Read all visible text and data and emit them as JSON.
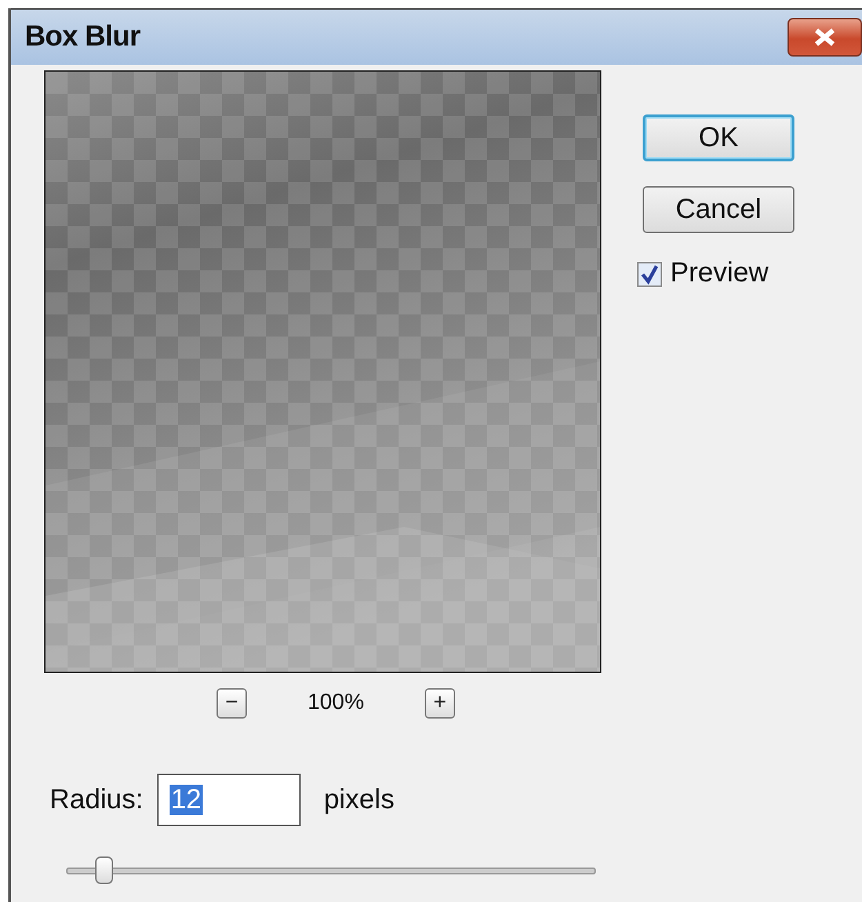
{
  "window": {
    "title": "Box Blur"
  },
  "preview": {
    "zoom": "100%",
    "zoom_out": "−",
    "zoom_in": "+"
  },
  "buttons": [
    {
      "label": "OK",
      "default": true
    },
    {
      "label": "Cancel",
      "default": false
    }
  ],
  "preview_option": {
    "label": "Preview",
    "checked": true
  },
  "radius": {
    "label": "Radius:",
    "value": "12",
    "unit": "pixels",
    "level": 0.06
  }
}
